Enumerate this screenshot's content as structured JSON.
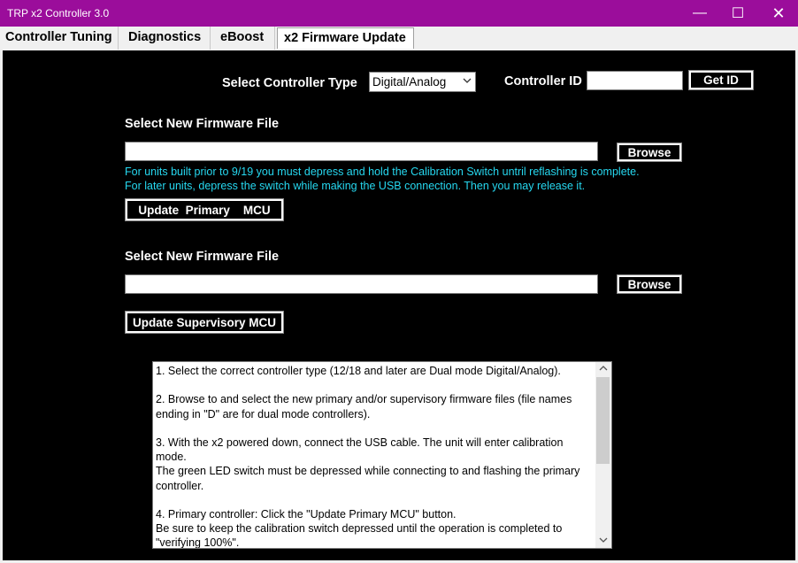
{
  "window": {
    "title": "TRP x2  Controller 3.0",
    "minimize_glyph": "—",
    "maximize_glyph": "☐",
    "close_glyph": "✕"
  },
  "tabs": [
    {
      "label": "Controller Tuning",
      "active": false
    },
    {
      "label": "Diagnostics",
      "active": false
    },
    {
      "label": "eBoost",
      "active": false
    },
    {
      "label": "x2 Firmware Update",
      "active": true
    }
  ],
  "controller": {
    "type_label": "Select Controller Type",
    "type_value": "Digital/Analog",
    "id_label": "Controller ID",
    "id_value": "",
    "get_id_label": "Get ID"
  },
  "primary": {
    "file_label": "Select New Firmware File",
    "file_value": "",
    "browse_label": "Browse",
    "note_line1": "For units built prior to 9/19 you must depress and hold the Calibration Switch untril reflashing is complete.",
    "note_line2": "For later units, depress the switch while making the USB connection. Then you may release it.",
    "update_label": "Update  Primary    MCU"
  },
  "supervisory": {
    "file_label": "Select New Firmware File",
    "file_value": "",
    "browse_label": "Browse",
    "update_label": "Update Supervisory MCU"
  },
  "instructions": [
    "1. Select the correct controller type (12/18 and later are Dual mode Digital/Analog).",
    "2. Browse to and select the new primary and/or supervisory firmware files (file names ending in \"D\" are for dual mode controllers).",
    "3. With the x2 powered down, connect the USB cable. The unit will enter calibration mode.\nThe green LED switch must be depressed while connecting to and flashing the primary controller.",
    "4. Primary controller:  Click the \"Update Primary MCU\" button.\nBe sure to keep the calibration switch depressed until the operation is completed to \"verifying 100%\"."
  ],
  "icons": {
    "dropdown": "chevron-down-icon",
    "scroll_up": "chevron-up-icon",
    "scroll_down": "chevron-down-icon"
  }
}
